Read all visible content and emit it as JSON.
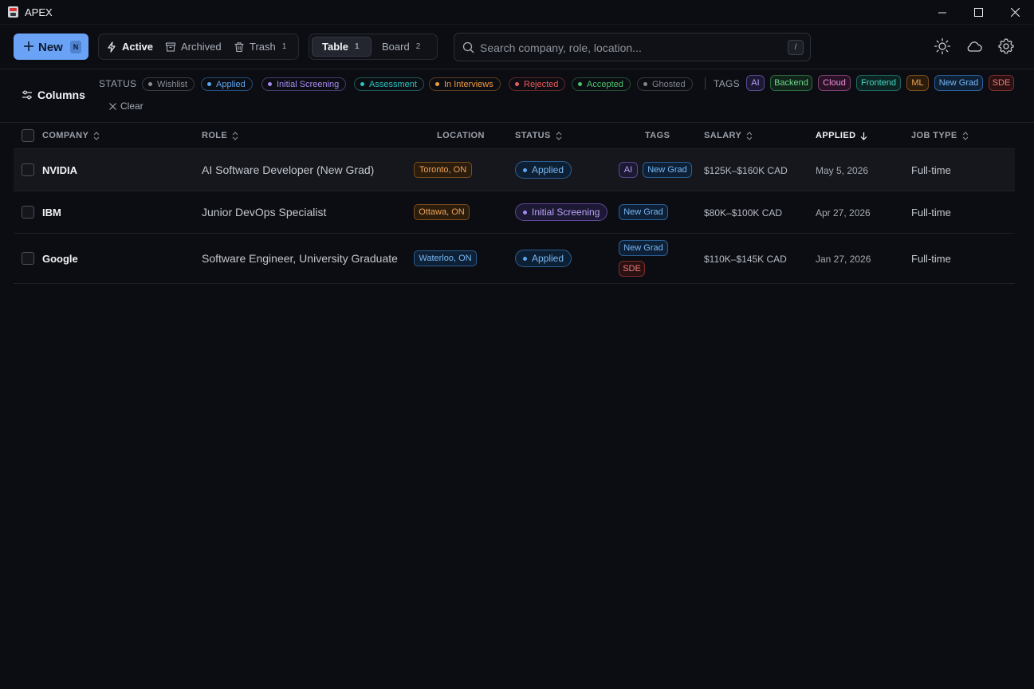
{
  "window": {
    "title": "APEX"
  },
  "toolbar": {
    "new_label": "New",
    "new_shortcut": "N",
    "views": [
      {
        "label": "Active",
        "icon": "bolt-icon"
      },
      {
        "label": "Archived",
        "icon": "archive-icon"
      },
      {
        "label": "Trash",
        "icon": "trash-icon",
        "count": "1"
      }
    ],
    "layouts": [
      {
        "label": "Table",
        "count": "1"
      },
      {
        "label": "Board",
        "count": "2"
      }
    ],
    "search_placeholder": "Search company, role, location...",
    "search_shortcut": "/"
  },
  "filters": {
    "columns_label": "Columns",
    "status_label": "STATUS",
    "statuses": [
      {
        "label": "Wishlist",
        "color": "#8a8f99"
      },
      {
        "label": "Applied",
        "color": "#5aa5f0"
      },
      {
        "label": "Initial Screening",
        "color": "#a58bf0"
      },
      {
        "label": "Assessment",
        "color": "#2cc2c2"
      },
      {
        "label": "In Interviews",
        "color": "#f09a3e"
      },
      {
        "label": "Rejected",
        "color": "#ee5a5a"
      },
      {
        "label": "Accepted",
        "color": "#4cc46a"
      },
      {
        "label": "Ghosted",
        "color": "#7f848e"
      }
    ],
    "tags_label": "TAGS",
    "tags": [
      {
        "label": "AI",
        "color": "#a58bf0"
      },
      {
        "label": "Backend",
        "color": "#4cc46a"
      },
      {
        "label": "Cloud",
        "color": "#e07fd0"
      },
      {
        "label": "Frontend",
        "color": "#2cc2b0"
      },
      {
        "label": "ML",
        "color": "#f09a3e"
      },
      {
        "label": "New Grad",
        "color": "#5aa5f0"
      },
      {
        "label": "SDE",
        "color": "#ee5a5a"
      }
    ],
    "clear_label": "Clear"
  },
  "table": {
    "columns": [
      "COMPANY",
      "ROLE",
      "LOCATION",
      "STATUS",
      "TAGS",
      "SALARY",
      "APPLIED",
      "JOB TYPE"
    ],
    "rows": [
      {
        "company": "NVIDIA",
        "role": "AI Software Developer (New Grad)",
        "location": "Toronto, ON",
        "status": "Applied",
        "tags": [
          "AI",
          "New Grad"
        ],
        "salary": "$125K–$160K CAD",
        "applied": "May 5, 2026",
        "job_type": "Full-time"
      },
      {
        "company": "IBM",
        "role": "Junior DevOps Specialist",
        "location": "Ottawa, ON",
        "status": "Initial Screening",
        "tags": [
          "New Grad"
        ],
        "salary": "$80K–$100K CAD",
        "applied": "Apr 27, 2026",
        "job_type": "Full-time"
      },
      {
        "company": "Google",
        "role": "Software Engineer, University Graduate",
        "location": "Waterloo, ON",
        "status": "Applied",
        "tags": [
          "New Grad",
          "SDE"
        ],
        "salary": "$110K–$145K CAD",
        "applied": "Jan 27, 2026",
        "job_type": "Full-time"
      }
    ]
  }
}
